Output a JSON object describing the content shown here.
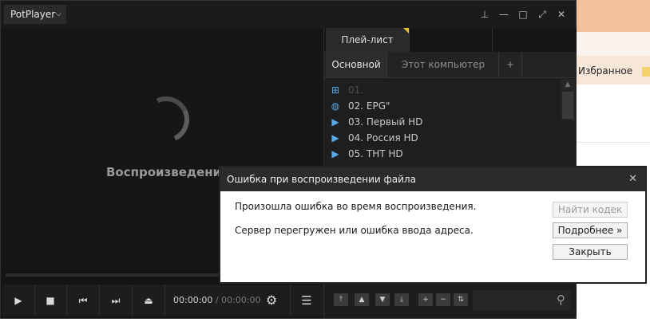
{
  "background_app": {
    "bookmark_label": "Избранное"
  },
  "titlebar": {
    "app_name": "PotPlayer",
    "dropdown_icon": "chevron-down-icon",
    "window_buttons": [
      {
        "name": "pin-icon",
        "glyph": "⊥"
      },
      {
        "name": "minimize-icon",
        "glyph": "—"
      },
      {
        "name": "maximize-icon",
        "glyph": "□"
      },
      {
        "name": "fullscreen-icon",
        "glyph": "⤢"
      },
      {
        "name": "close-icon",
        "glyph": "✕"
      }
    ]
  },
  "video": {
    "status_text": "Воспроизведение..."
  },
  "controls": {
    "current_time": "00:00:00",
    "separator": "/",
    "duration": "00:00:00"
  },
  "playlist": {
    "tab_label": "Плей-лист",
    "subtabs": {
      "main": "Основной",
      "computer": "Этот компьютер",
      "add": "+"
    },
    "items": [
      {
        "label": "01.",
        "icon": "network-folder-icon",
        "dim": true
      },
      {
        "label": "02. EPG\"",
        "icon": "globe-icon",
        "dim": false
      },
      {
        "label": "03. Первый HD",
        "icon": "play-icon",
        "dim": false
      },
      {
        "label": "04. Россия HD",
        "icon": "play-icon",
        "dim": false
      },
      {
        "label": "05. ТНТ HD",
        "icon": "play-icon",
        "dim": false
      }
    ]
  },
  "dialog": {
    "title": "Ошибка при воспроизведении файла",
    "message1": "Произошла ошибка во время воспроизведения.",
    "message2": "Сервер перегружен или ошибка ввода адреса.",
    "buttons": {
      "find_codec": "Найти кодек",
      "details": "Подробнее »",
      "close": "Закрыть"
    }
  }
}
